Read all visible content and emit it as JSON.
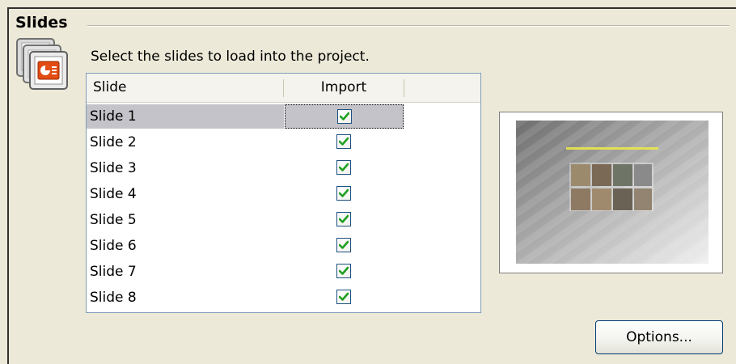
{
  "group": {
    "title": "Slides"
  },
  "instruction": "Select the slides to load into the project.",
  "slide_list": {
    "columns": [
      "Slide",
      "Import"
    ],
    "rows": [
      {
        "label": "Slide 1",
        "import": true,
        "selected": true
      },
      {
        "label": "Slide 2",
        "import": true,
        "selected": false
      },
      {
        "label": "Slide 3",
        "import": true,
        "selected": false
      },
      {
        "label": "Slide 4",
        "import": true,
        "selected": false
      },
      {
        "label": "Slide 5",
        "import": true,
        "selected": false
      },
      {
        "label": "Slide 6",
        "import": true,
        "selected": false
      },
      {
        "label": "Slide 7",
        "import": true,
        "selected": false
      },
      {
        "label": "Slide 8",
        "import": true,
        "selected": false
      }
    ]
  },
  "options_button": "Options...",
  "icons": {
    "group_icon": "slides-stack-icon",
    "check": "checkmark-icon"
  },
  "colors": {
    "selection": "#c3c3c9",
    "check_green": "#20a020",
    "list_border": "#7f9db9",
    "button_border": "#003c74"
  }
}
